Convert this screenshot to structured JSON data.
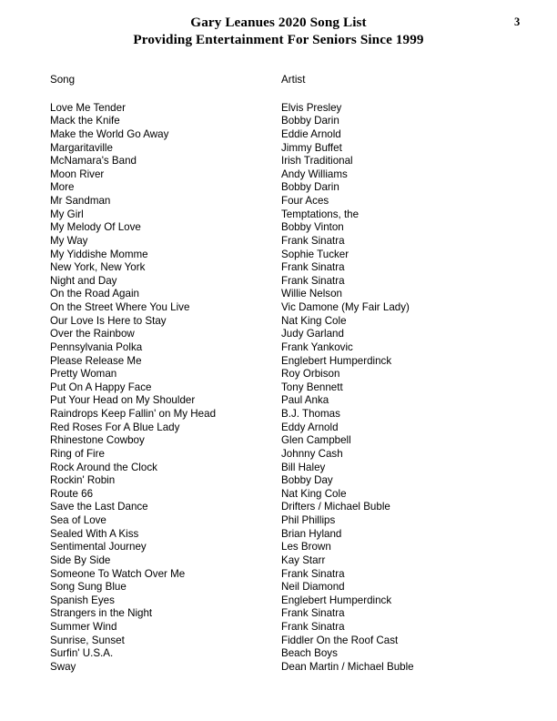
{
  "header": {
    "title_line1": "Gary Leanues 2020 Song List",
    "title_line2": "Providing Entertainment For Seniors Since 1999",
    "page_number": "3"
  },
  "table": {
    "columns": [
      "Song",
      "Artist"
    ],
    "rows": [
      [
        "Love Me Tender",
        "Elvis Presley"
      ],
      [
        "Mack the Knife",
        "Bobby Darin"
      ],
      [
        "Make the World Go Away",
        "Eddie Arnold"
      ],
      [
        "Margaritaville",
        "Jimmy Buffet"
      ],
      [
        "McNamara's Band",
        "Irish Traditional"
      ],
      [
        "Moon River",
        "Andy Williams"
      ],
      [
        "More",
        "Bobby Darin"
      ],
      [
        "Mr Sandman",
        "Four Aces"
      ],
      [
        "My Girl",
        "Temptations, the"
      ],
      [
        "My Melody Of Love",
        "Bobby Vinton"
      ],
      [
        "My Way",
        "Frank Sinatra"
      ],
      [
        "My Yiddishe Momme",
        "Sophie Tucker"
      ],
      [
        "New York, New York",
        "Frank Sinatra"
      ],
      [
        "Night and Day",
        "Frank Sinatra"
      ],
      [
        "On the Road Again",
        "Willie Nelson"
      ],
      [
        "On the Street Where You Live",
        "Vic Damone (My Fair Lady)"
      ],
      [
        "Our Love Is Here to Stay",
        "Nat King Cole"
      ],
      [
        "Over the Rainbow",
        "Judy Garland"
      ],
      [
        "Pennsylvania Polka",
        "Frank Yankovic"
      ],
      [
        "Please Release Me",
        "Englebert Humperdinck"
      ],
      [
        "Pretty Woman",
        "Roy Orbison"
      ],
      [
        "Put On A Happy Face",
        "Tony Bennett"
      ],
      [
        "Put Your Head on My Shoulder",
        "Paul Anka"
      ],
      [
        "Raindrops Keep Fallin' on My Head",
        "B.J. Thomas"
      ],
      [
        "Red Roses For A Blue Lady",
        "Eddy Arnold"
      ],
      [
        "Rhinestone Cowboy",
        "Glen Campbell"
      ],
      [
        "Ring of Fire",
        "Johnny Cash"
      ],
      [
        "Rock Around the Clock",
        "Bill Haley"
      ],
      [
        "Rockin' Robin",
        "Bobby Day"
      ],
      [
        "Route 66",
        "Nat King Cole"
      ],
      [
        "Save the Last Dance",
        "Drifters / Michael Buble"
      ],
      [
        "Sea of Love",
        "Phil Phillips"
      ],
      [
        "Sealed With A Kiss",
        "Brian Hyland"
      ],
      [
        "Sentimental Journey",
        "Les Brown"
      ],
      [
        "Side By Side",
        "Kay Starr"
      ],
      [
        "Someone To Watch Over Me",
        "Frank Sinatra"
      ],
      [
        "Song Sung Blue",
        "Neil Diamond"
      ],
      [
        "Spanish Eyes",
        "Englebert Humperdinck"
      ],
      [
        "Strangers in the Night",
        "Frank Sinatra"
      ],
      [
        "Summer Wind",
        "Frank Sinatra"
      ],
      [
        "Sunrise, Sunset",
        "Fiddler On the Roof Cast"
      ],
      [
        "Surfin' U.S.A.",
        "Beach Boys"
      ],
      [
        "Sway",
        "Dean Martin / Michael Buble"
      ]
    ]
  }
}
